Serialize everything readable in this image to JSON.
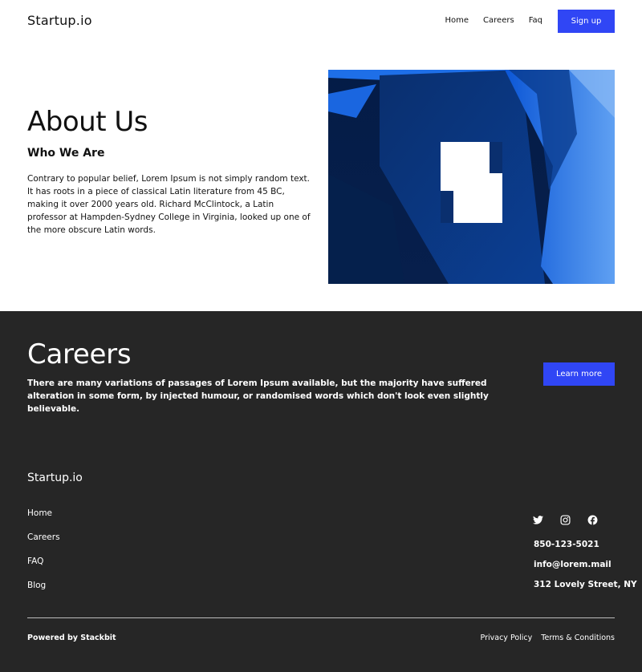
{
  "header": {
    "logo": "Startup.io",
    "nav": [
      "Home",
      "Careers",
      "Faq"
    ],
    "signup_label": "Sign up"
  },
  "about": {
    "title": "About Us",
    "subtitle": "Who We Are",
    "text": "Contrary to popular belief, Lorem Ipsum is not simply random text. It has roots in a piece of classical Latin literature from 45 BC, making it over 2000 years old. Richard McClintock, a Latin professor at Hampden-Sydney College in Virginia, looked up one of the more obscure Latin words."
  },
  "careers": {
    "title": "Careers",
    "text": "There are many variations of passages of Lorem Ipsum available, but the majority have suffered alteration in some form, by injected humour, or randomised words which don't look even slightly believable.",
    "button_label": "Learn more"
  },
  "footer": {
    "logo": "Startup.io",
    "links": [
      "Home",
      "Careers",
      "FAQ",
      "Blog"
    ],
    "social_icons": [
      "twitter-icon",
      "instagram-icon",
      "facebook-icon"
    ],
    "phone": "850-123-5021",
    "email": "info@lorem.mail",
    "address": "312 Lovely Street, NY",
    "powered": "Powered by Stackbit",
    "legal": [
      "Privacy Policy",
      "Terms & Conditions"
    ]
  },
  "colors": {
    "accent": "#3046f5",
    "dark_bg": "#262626",
    "hero_blue": "#1e6fe8"
  }
}
